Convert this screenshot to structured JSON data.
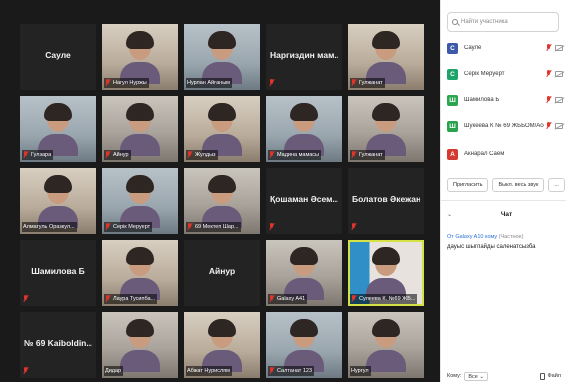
{
  "gallery": {
    "tiles": [
      {
        "name": "Сауле",
        "label": "",
        "kind": "name",
        "muted": false
      },
      {
        "name": "",
        "label": "Нагул Нуржы",
        "kind": "video",
        "muted": true
      },
      {
        "name": "",
        "label": "Нурлан Айғаным",
        "kind": "video",
        "muted": false
      },
      {
        "name": "Наргиздин мам...",
        "label": "",
        "kind": "name",
        "muted": true
      },
      {
        "name": "",
        "label": "Гулжанат",
        "kind": "video",
        "muted": true
      },
      {
        "name": "",
        "label": "Гулзара",
        "kind": "video",
        "muted": true
      },
      {
        "name": "",
        "label": "Айнур",
        "kind": "video",
        "muted": true
      },
      {
        "name": "",
        "label": "Жулдыз",
        "kind": "video",
        "muted": true
      },
      {
        "name": "",
        "label": "Мадина мамасы",
        "kind": "video",
        "muted": true
      },
      {
        "name": "",
        "label": "Гулжанат",
        "kind": "video",
        "muted": true
      },
      {
        "name": "",
        "label": "Алмагуль Оразкул...",
        "kind": "video",
        "muted": false
      },
      {
        "name": "",
        "label": "Серік Меруерт",
        "kind": "video",
        "muted": true
      },
      {
        "name": "",
        "label": "69 Мектеп Шар...",
        "kind": "video",
        "muted": true
      },
      {
        "name": "Қошаман Әсем...",
        "label": "",
        "kind": "name",
        "muted": true
      },
      {
        "name": "Болатов Әкежан",
        "label": "",
        "kind": "name",
        "muted": true
      },
      {
        "name": "Шамилова Б",
        "label": "",
        "kind": "name",
        "muted": true
      },
      {
        "name": "",
        "label": "Лаура Тусипба...",
        "kind": "video",
        "muted": true
      },
      {
        "name": "Айнур",
        "label": "",
        "kind": "name",
        "muted": false
      },
      {
        "name": "",
        "label": "Galaxy A41",
        "kind": "video",
        "muted": true
      },
      {
        "name": "",
        "label": "Сулеева К. №69 ЖБ...",
        "kind": "video",
        "muted": true
      },
      {
        "name": "№ 69 Kaiboldin...",
        "label": "",
        "kind": "name",
        "muted": true
      },
      {
        "name": "",
        "label": "Дидар",
        "kind": "video",
        "muted": false
      },
      {
        "name": "",
        "label": "Абжат Нурислям",
        "kind": "video",
        "muted": false
      },
      {
        "name": "",
        "label": "Салтанат 123",
        "kind": "video",
        "muted": true
      },
      {
        "name": "",
        "label": "Нургул",
        "kind": "video",
        "muted": false
      }
    ]
  },
  "panel": {
    "search_placeholder": "Найти участника",
    "participants": [
      {
        "initial": "С",
        "name": "Сауле",
        "color": "#3d5aa8"
      },
      {
        "initial": "С",
        "name": "Серік Меруерт",
        "color": "#1fa36a"
      },
      {
        "initial": "Ш",
        "name": "Шамилова Б",
        "color": "#2ba64e"
      },
      {
        "initial": "Ш",
        "name": "Шукеева К № 69 ЖББОМ/Асему...",
        "color": "#2aa14b"
      },
      {
        "initial": "А",
        "name": "Акнарал Саем",
        "color": "#d43a2f"
      }
    ],
    "invite_label": "Пригласить",
    "mute_all_label": "Выкл. весь звук",
    "more_label": "...",
    "chat_collapse": "⌄",
    "chat_title": "Чат",
    "message": {
      "from": "От Galaxy A10 кому",
      "to": "(Частное)",
      "text": "дауыс шыгпайды саленатсызба"
    },
    "bottom": {
      "to_label": "Кому:",
      "to_value": "Все ⌄",
      "file_label": "Файл"
    }
  },
  "colors": {
    "active_border": "#d5e246",
    "mic_off": "#e0342b"
  }
}
